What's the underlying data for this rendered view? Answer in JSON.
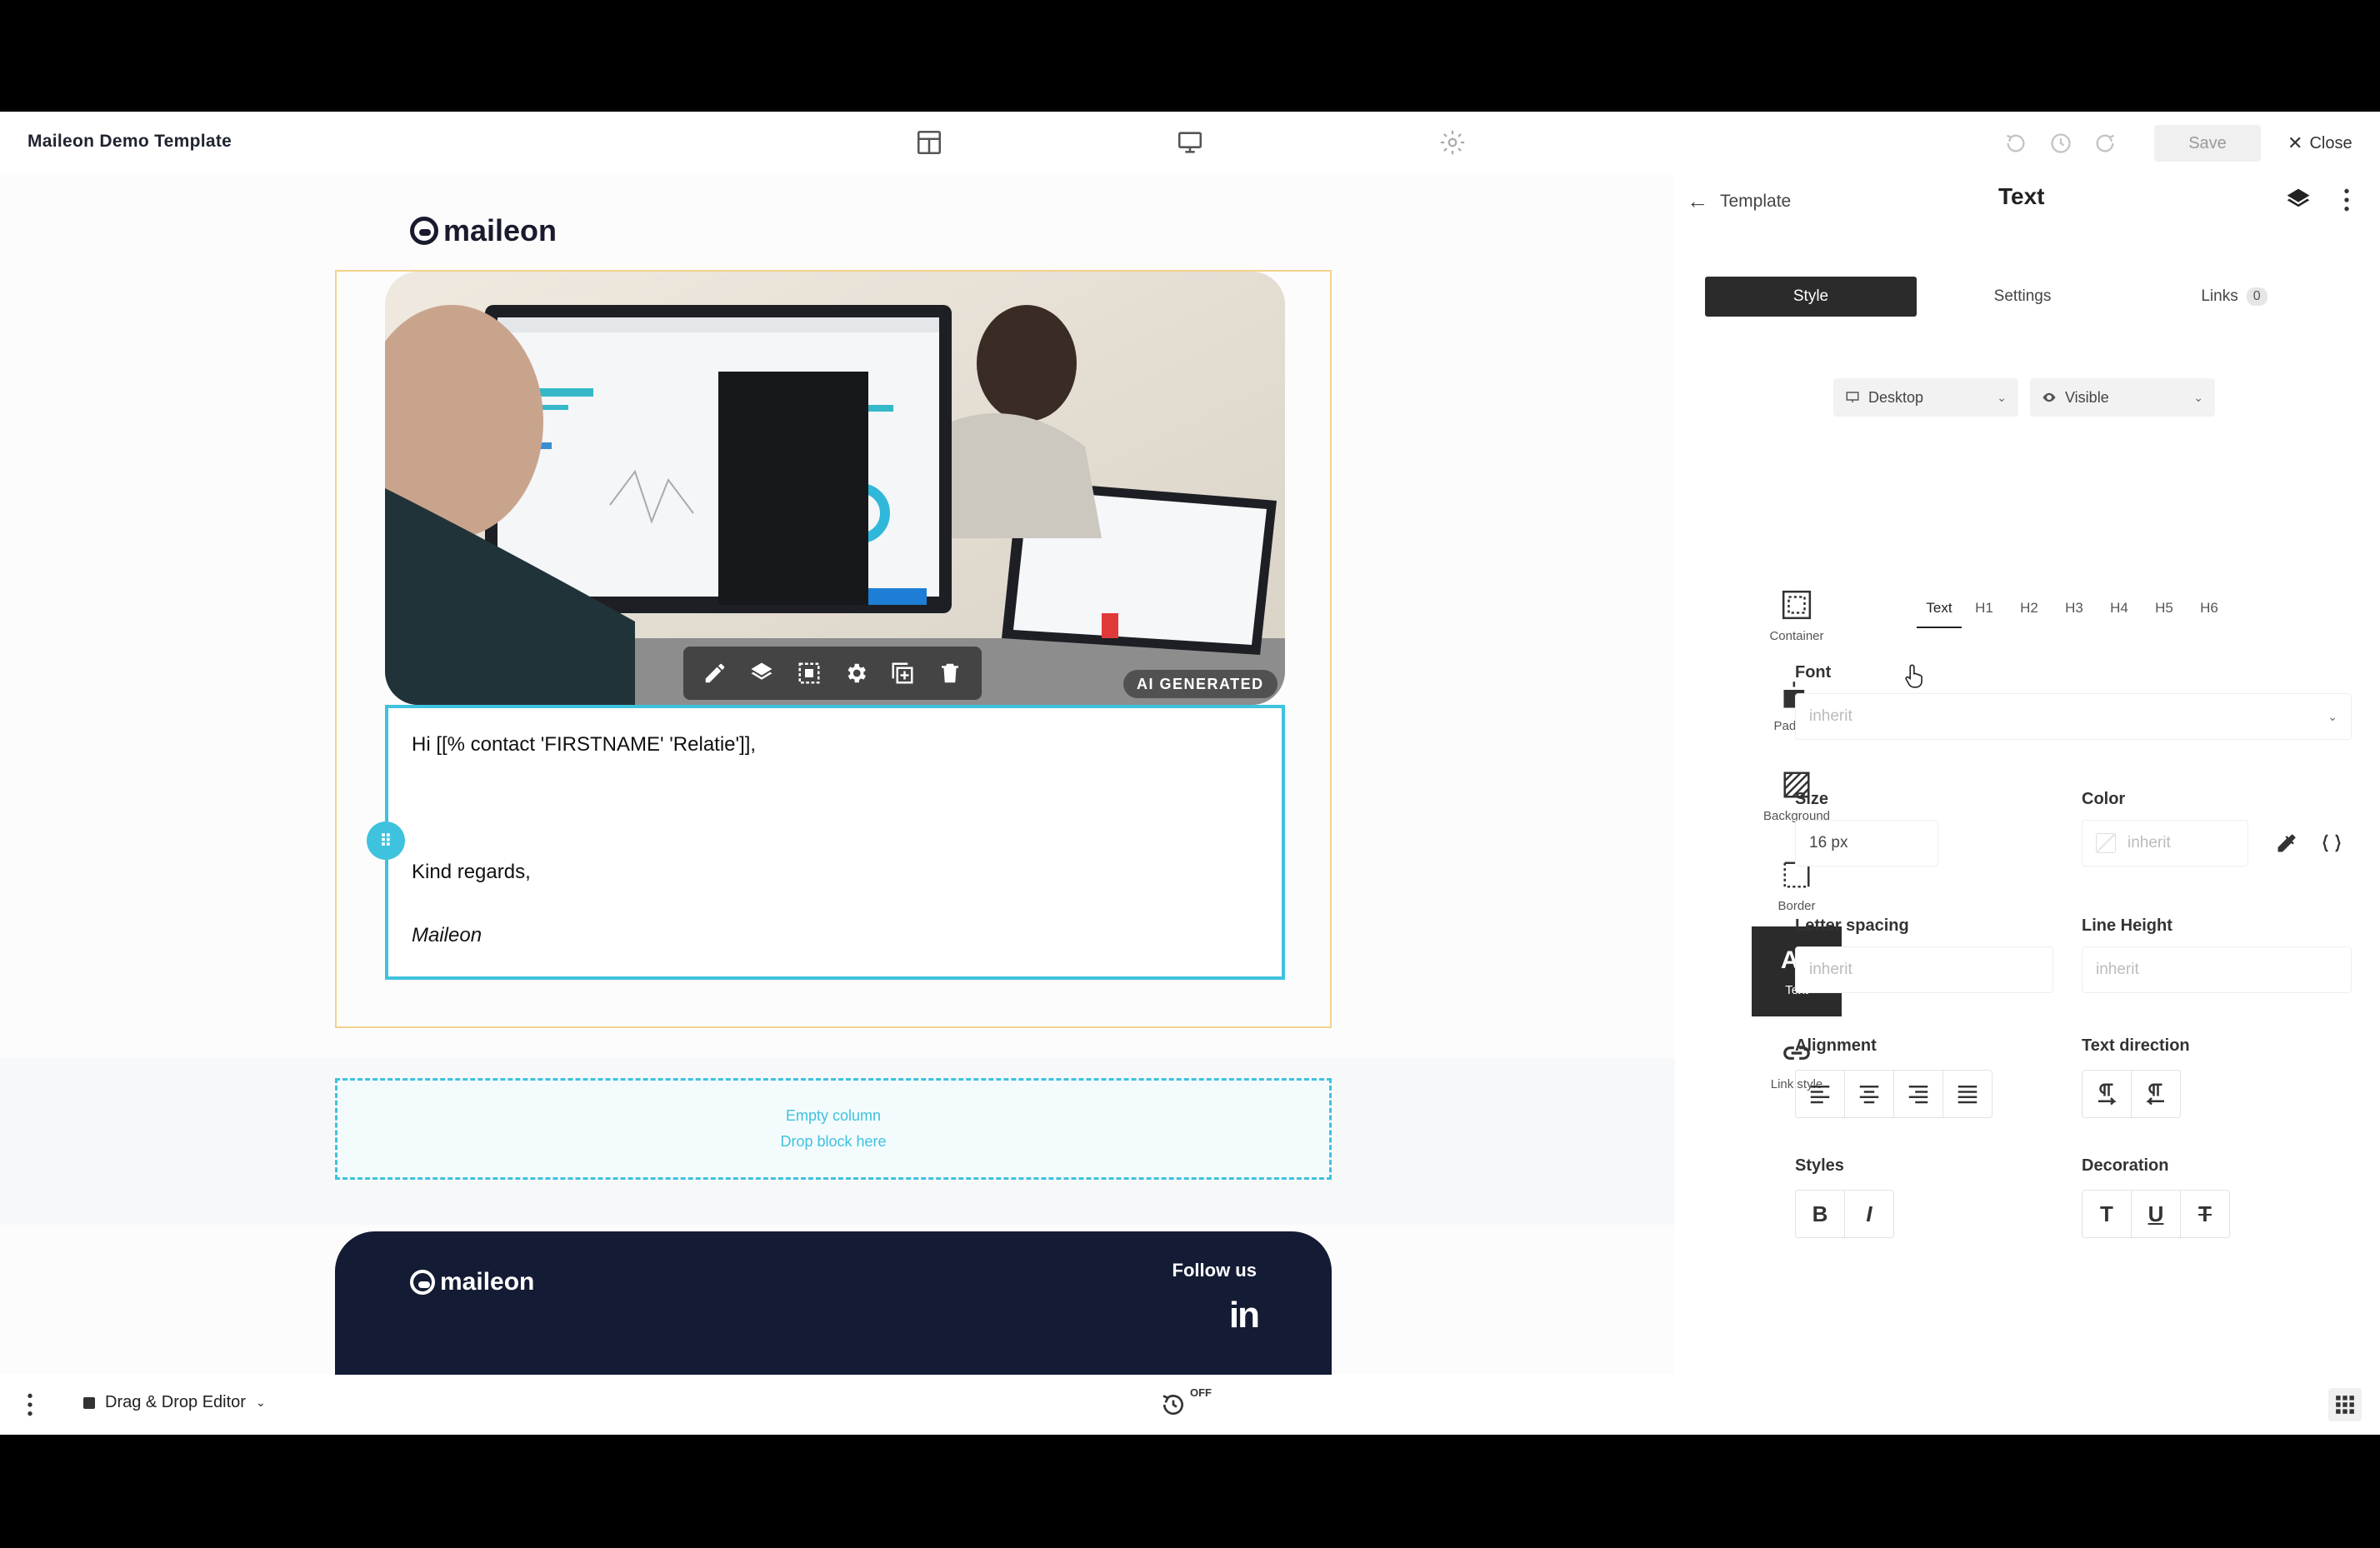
{
  "header": {
    "title": "Maileon Demo Template",
    "save_label": "Save",
    "close_label": "Close"
  },
  "canvas": {
    "logo_text": "maileon",
    "ai_badge": "AI GENERATED",
    "text_block": {
      "line1": "Hi [[% contact 'FIRSTNAME' 'Relatie']],",
      "line2": "Kind regards,",
      "line3": "Maileon"
    },
    "empty_column": {
      "line1": "Empty column",
      "line2": "Drop block here"
    },
    "footer": {
      "logo_text": "maileon",
      "follow_label": "Follow us",
      "social": "in"
    }
  },
  "panel": {
    "back_label": "Template",
    "title": "Text",
    "tabs": {
      "style": "Style",
      "settings": "Settings",
      "links": "Links",
      "links_count": "0"
    },
    "device": "Desktop",
    "visibility": "Visible",
    "rail": {
      "container": "Container",
      "padding": "Padding",
      "background": "Background",
      "border": "Border",
      "text_icon": "Aa",
      "text": "Text",
      "link_style": "Link style"
    },
    "heading_tabs": [
      "Text",
      "H1",
      "H2",
      "H3",
      "H4",
      "H5",
      "H6"
    ],
    "labels": {
      "font": "Font",
      "size": "Size",
      "color": "Color",
      "letter_spacing": "Letter spacing",
      "line_height": "Line Height",
      "alignment": "Alignment",
      "text_direction": "Text direction",
      "styles": "Styles",
      "decoration": "Decoration"
    },
    "values": {
      "font": "inherit",
      "size": "16 px",
      "color": "inherit",
      "letter_spacing": "inherit",
      "line_height": "inherit"
    },
    "style_buttons": {
      "bold": "B",
      "italic": "I"
    },
    "decoration_buttons": {
      "none": "T",
      "underline": "U",
      "strike": "T"
    }
  },
  "footer_bar": {
    "editor_mode": "Drag & Drop Editor",
    "autosave_state": "OFF"
  }
}
